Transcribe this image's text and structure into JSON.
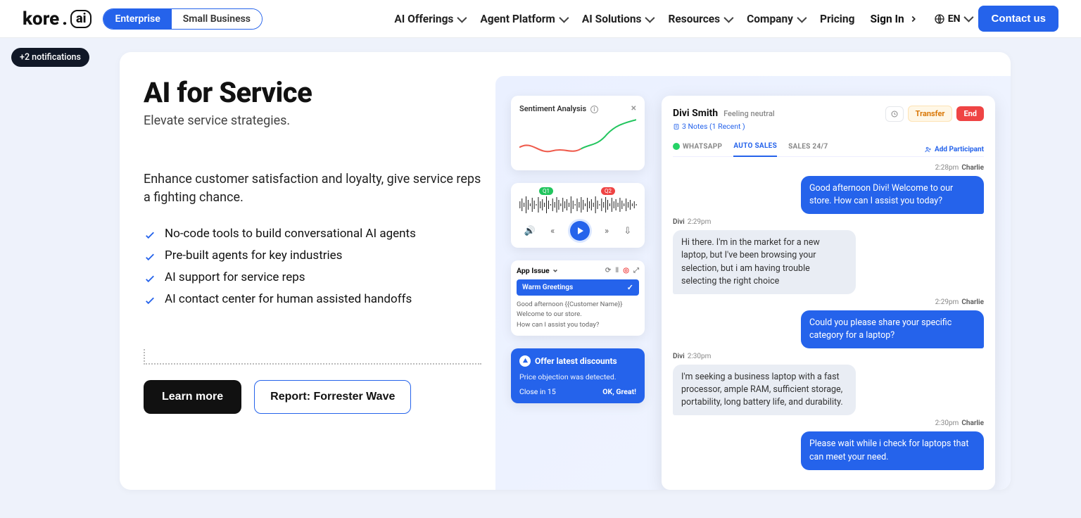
{
  "header": {
    "seg_a": "Enterprise",
    "seg_b": "Small Business",
    "nav": [
      "AI Offerings",
      "Agent Platform",
      "AI Solutions",
      "Resources",
      "Company"
    ],
    "pricing": "Pricing",
    "signin": "Sign In",
    "lang": "EN",
    "contact": "Contact us"
  },
  "notif": "+2 notifications",
  "hero": {
    "title": "AI for Service",
    "subtitle": "Elevate service strategies.",
    "desc": "Enhance customer satisfaction and loyalty, give service reps a fighting chance.",
    "bullets": [
      "No-code tools to build conversational AI agents",
      "Pre-built agents for key industries",
      "AI support for service reps",
      "AI contact center for human assisted handoffs"
    ],
    "cta1": "Learn more",
    "cta2": "Report: Forrester Wave"
  },
  "sentiment": {
    "title": "Sentiment Analysis"
  },
  "appissue": {
    "title": "App Issue",
    "warm": "Warm Greetings",
    "l1": "Good afternoon {{Customer Name}}",
    "l2": "Welcome to our store.",
    "l3": "How can I assist you today?"
  },
  "offer": {
    "title": "Offer latest discounts",
    "l1": "Price objection was detected.",
    "close": "Close in 15",
    "ok": "OK, Great!"
  },
  "chat": {
    "name": "Divi Smith",
    "mood": "Feeling neutral",
    "notes": "3 Notes (1 Recent )",
    "transfer": "Transfer",
    "end": "End",
    "tab1": "WHATSAPP",
    "tab2": "AUTO SALES",
    "tab3": "SALES 24/7",
    "add": "Add Participant",
    "m1_meta": "2:28pm",
    "m1_name": "Charlie",
    "m1": "Good afternoon Divi! Welcome to our store. How can I assist you today?",
    "m2_name": "Divi",
    "m2_meta": "2:29pm",
    "m2": "Hi there. I'm in the market for a new laptop, but I've been browsing your selection, but i am having trouble selecting the right choice",
    "m3_meta": "2:29pm",
    "m3_name": "Charlie",
    "m3": "Could you please share your specific category for a laptop?",
    "m4_name": "Divi",
    "m4_meta": "2:30pm",
    "m4": "I'm seeking a business laptop with a fast processor, ample RAM, sufficient storage, portability, long battery life, and durability.",
    "m5_meta": "2:30pm",
    "m5_name": "Charlie",
    "m5": "Please wait while i check for laptops that can meet your need."
  }
}
